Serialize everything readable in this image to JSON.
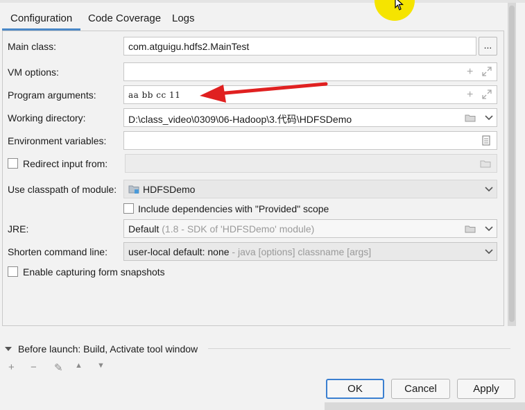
{
  "tabs": [
    {
      "label": "Configuration"
    },
    {
      "label": "Code Coverage"
    },
    {
      "label": "Logs"
    }
  ],
  "form": {
    "main_class": {
      "label": "Main class:",
      "value": "com.atguigu.hdfs2.MainTest",
      "browse_label": "..."
    },
    "vm_options": {
      "label": "VM options:",
      "value": ""
    },
    "program_arguments": {
      "label": "Program arguments:",
      "value": "aa bb cc 11"
    },
    "working_directory": {
      "label": "Working directory:",
      "value": "D:\\class_video\\0309\\06-Hadoop\\3.代码\\HDFSDemo"
    },
    "environment_variables": {
      "label": "Environment variables:",
      "value": ""
    },
    "redirect_input": {
      "label": "Redirect input from:",
      "checked": false,
      "value": ""
    },
    "classpath_module": {
      "label": "Use classpath of module:",
      "value": "HDFSDemo"
    },
    "include_dependencies": {
      "label": "Include dependencies with \"Provided\" scope",
      "checked": false
    },
    "jre": {
      "label": "JRE:",
      "value": "Default",
      "hint": " (1.8 - SDK of 'HDFSDemo' module)"
    },
    "shorten_command_line": {
      "label": "Shorten command line:",
      "value": "user-local default: none",
      "hint": " - java [options] classname [args]"
    },
    "capture_snapshots": {
      "label": "Enable capturing form snapshots",
      "checked": false
    }
  },
  "before_launch": {
    "label": "Before launch: Build, Activate tool window"
  },
  "buttons": {
    "ok": "OK",
    "cancel": "Cancel",
    "apply": "Apply"
  },
  "colors": {
    "annotation_arrow": "#e02020",
    "cursor_highlight": "#f5e400",
    "accent": "#4a88c7"
  },
  "icons": [
    "expand-icon",
    "add-icon",
    "folder-icon",
    "chevron-down-icon",
    "document-icon",
    "module-icon",
    "mouse-cursor-icon"
  ]
}
